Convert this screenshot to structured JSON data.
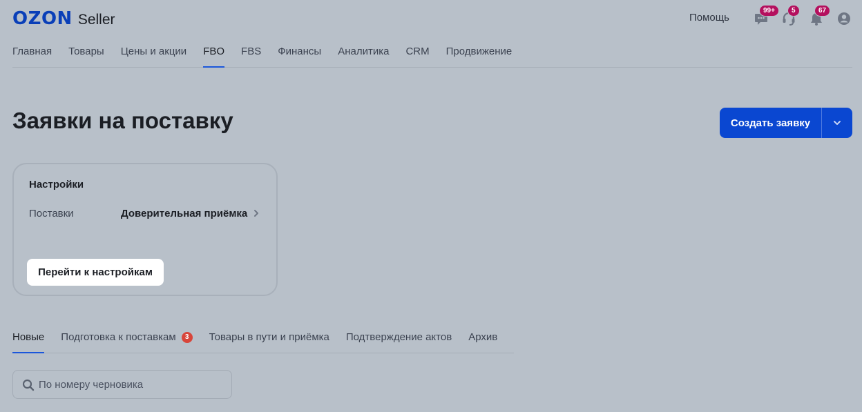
{
  "header": {
    "logo_brand": "OZON",
    "logo_product": "Seller",
    "help_label": "Помощь",
    "icons": [
      {
        "name": "chat-icon",
        "badge": "99+"
      },
      {
        "name": "support-icon",
        "badge": "5"
      },
      {
        "name": "bell-icon",
        "badge": "67"
      },
      {
        "name": "account-icon"
      }
    ]
  },
  "nav": {
    "items": [
      {
        "label": "Главная"
      },
      {
        "label": "Товары"
      },
      {
        "label": "Цены и акции"
      },
      {
        "label": "FBO",
        "active": true
      },
      {
        "label": "FBS"
      },
      {
        "label": "Финансы"
      },
      {
        "label": "Аналитика"
      },
      {
        "label": "CRM"
      },
      {
        "label": "Продвижение"
      }
    ]
  },
  "page": {
    "title": "Заявки на поставку",
    "create_button": "Создать заявку"
  },
  "settings_card": {
    "title": "Настройки",
    "label": "Поставки",
    "value": "Доверительная приёмка",
    "button": "Перейти к настройкам"
  },
  "tabs": {
    "items": [
      {
        "label": "Новые",
        "active": true
      },
      {
        "label": "Подготовка к поставкам",
        "count": "3"
      },
      {
        "label": "Товары в пути и приёмка"
      },
      {
        "label": "Подтверждение актов"
      },
      {
        "label": "Архив"
      }
    ]
  },
  "search": {
    "placeholder": "По номеру черновика",
    "value": ""
  },
  "colors": {
    "background": "#b8c0c9",
    "accent": "#0a47d1",
    "badge": "#b4105e",
    "tab_count": "#d8453a"
  }
}
